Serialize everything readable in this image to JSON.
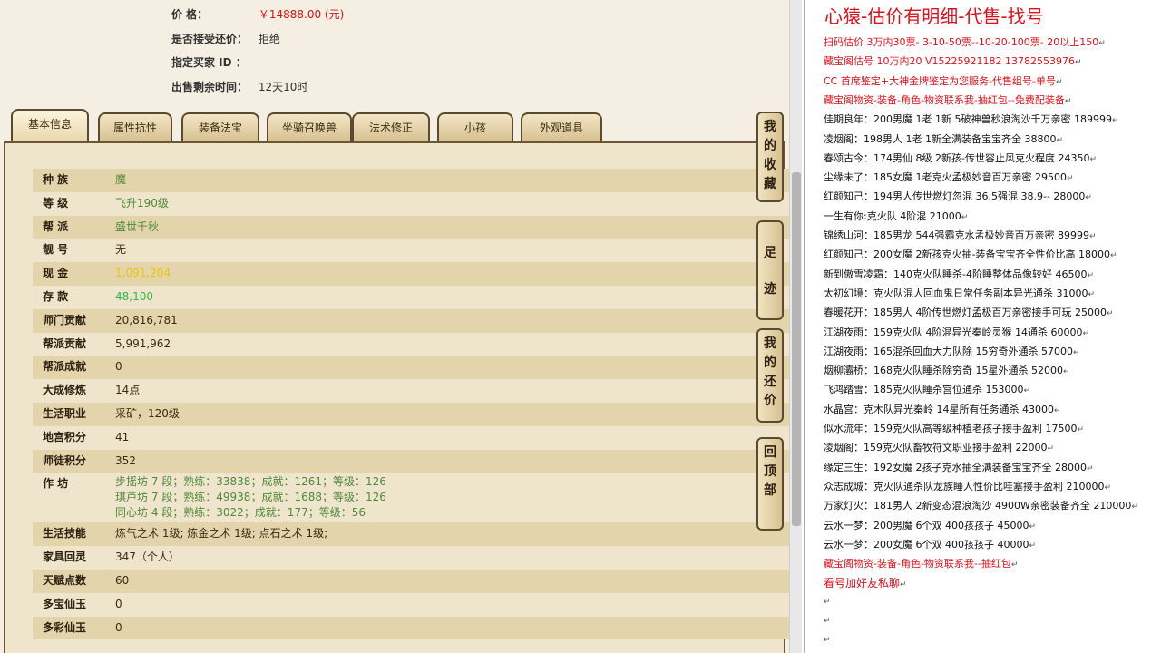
{
  "sale": {
    "price_label": "价 格：",
    "price_value": "￥14888.00 (元)",
    "bargain_label": "是否接受还价：",
    "bargain_value": "拒绝",
    "buyer_label": "指定买家 ID ：",
    "buyer_value": "",
    "time_label": "出售剩余时间：",
    "time_value": "12天10时"
  },
  "tabs": [
    "基本信息",
    "属性抗性",
    "装备法宝",
    "坐骑召唤兽",
    "法术修正",
    "小孩",
    "外观道具"
  ],
  "side_buttons": [
    "我的收藏",
    "足迹",
    "我的还价",
    "回顶部"
  ],
  "rows": [
    {
      "k": "种 族",
      "v": "魔"
    },
    {
      "k": "等 级",
      "v": "飞升190级"
    },
    {
      "k": "帮 派",
      "v": "盛世千秋"
    },
    {
      "k": "靓 号",
      "v": "无"
    },
    {
      "k": "现 金",
      "v": "1,091,204"
    },
    {
      "k": "存 款",
      "v": "48,100"
    },
    {
      "k": "师门贡献",
      "v": "20,816,781"
    },
    {
      "k": "帮派贡献",
      "v": "5,991,962"
    },
    {
      "k": "帮派成就",
      "v": "0"
    },
    {
      "k": "大成修炼",
      "v": "14点"
    },
    {
      "k": "生活职业",
      "v": "采矿，120级"
    },
    {
      "k": "地宫积分",
      "v": "41"
    },
    {
      "k": "师徒积分",
      "v": "352"
    },
    {
      "k": "作 坊",
      "v1": "步摇坊 7 段；熟练：33838；成就：1261；等级：126",
      "v2": "琪芦坊 7 段；熟练：49938；成就：1688；等级：126",
      "v3": "同心坊 4 段；熟练：3022；成就：177；等级：56"
    },
    {
      "k": "生活技能",
      "v": "炼气之术 1级; 炼金之术 1级; 点石之术 1级;"
    },
    {
      "k": "家具回灵",
      "v": "347（个人）"
    },
    {
      "k": "天赋点数",
      "v": "60"
    },
    {
      "k": "多宝仙玉",
      "v": "0"
    },
    {
      "k": "多彩仙玉",
      "v": "0"
    }
  ],
  "doc": {
    "title": "心猿-估价有明细-代售-找号",
    "lines": [
      "扫码估价 3万内30票- 3-10-50票--10-20-100票- 20以上150",
      "藏宝阁估号 10万内20 V15225921182  13782553976",
      "CC 首席鉴定+大神金牌鉴定为您服务-代售组号-单号",
      "藏宝阁物资-装备-角色-物资联系我-抽红包--免费配装备",
      "佳期良年：200男魔 1老 1新 5破神兽秒浪淘沙千万亲密 189999",
      "凌烟阁：198男人 1老 1新全满装备宝宝齐全 38800",
      "春颂古今：174男仙 8级 2新孩-传世容止风克火程度 24350",
      "尘缘未了：185女魔 1老克火孟极妙音百万亲密 29500",
      "红颜知己：194男人传世燃灯忽混 36.5强混 38.9-- 28000",
      "一生有你:克火队 4阶混 21000",
      "锦绣山河：185男龙 544强霸克水孟极妙音百万亲密 89999",
      "红颜知己：200女魔 2新孩克火抽-装备宝宝齐全性价比高 18000",
      "新到傲雪凌霜：140克火队睡杀-4阶睡整体品像较好 46500",
      "太初幻境：克火队混人回血鬼日常任务副本异光通杀 31000",
      "春暖花开：185男人 4阶传世燃灯孟极百万亲密接手可玩 25000",
      "江湖夜雨：159克火队 4阶混异光秦岭灵猴 14通杀 60000",
      "江湖夜雨：165混杀回血大力队除 15穷奇外通杀 57000",
      "烟柳灞桥：168克火队睡杀除穷奇 15星外通杀 52000",
      "飞鸿踏雪：185克火队睡杀宫位通杀 153000",
      "水晶宫：克木队异光秦岭 14星所有任务通杀 43000",
      "似水流年：159克火队高等级种植老孩子接手盈利 17500",
      "凌烟阁：159克火队畜牧符文职业接手盈利 22000",
      "缘定三生：192女魔 2孩子克水抽全满装备宝宝齐全 28000",
      "众志成城：克火队通杀队龙族睡人性价比哇塞接手盈利 210000",
      "万家灯火：181男人 2新变态混浪淘沙 4900W亲密装备齐全 210000",
      "云水一梦：200男魔 6个双 400孩孩子 45000",
      "云水一梦：200女魔 6个双 400孩孩子 40000",
      "藏宝阁物资-装备-角色-物资联系我--抽红包",
      "看号加好友私聊"
    ],
    "mark": "↵"
  },
  "colors": {
    "price_red": "#d41515",
    "doc_red": "#e0101a",
    "text_green": "#4f8a3a"
  }
}
